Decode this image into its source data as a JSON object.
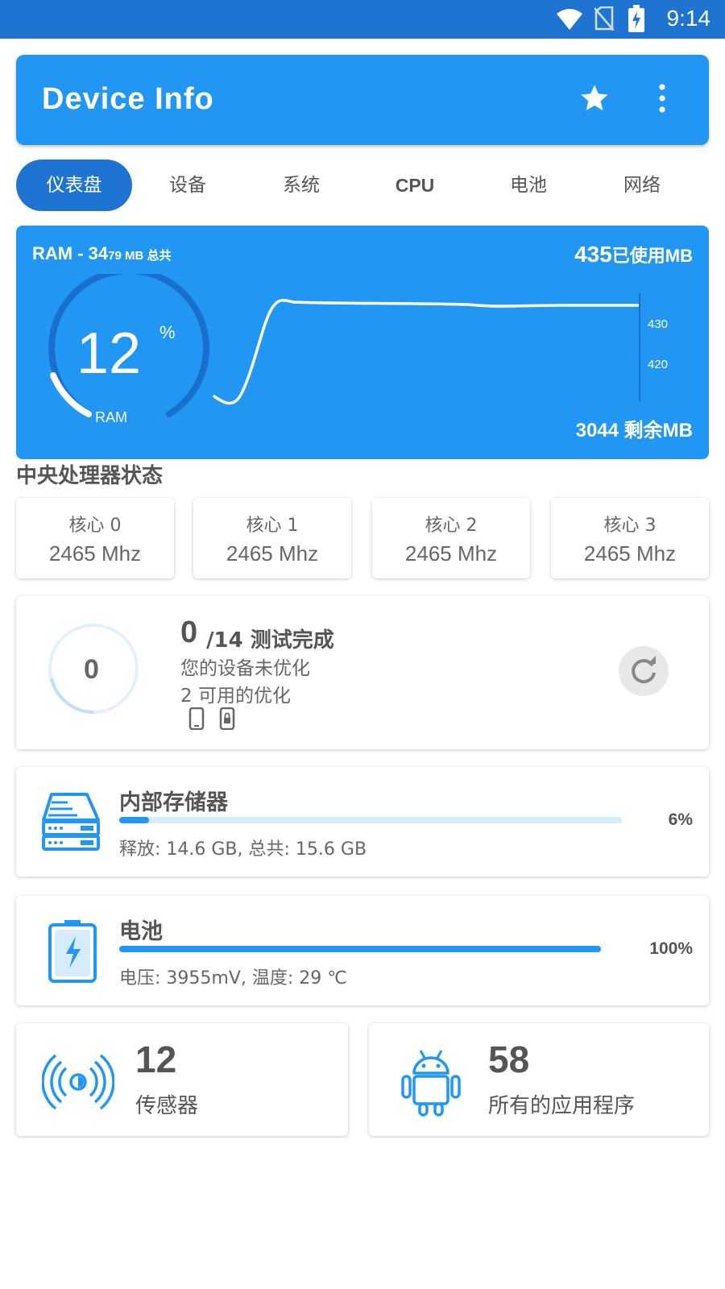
{
  "status_bar": {
    "time": "9:14"
  },
  "app_bar": {
    "title": "Device Info"
  },
  "tabs": [
    {
      "label": "仪表盘",
      "active": true
    },
    {
      "label": "设备"
    },
    {
      "label": "系统"
    },
    {
      "label": "CPU"
    },
    {
      "label": "电池"
    },
    {
      "label": "网络"
    }
  ],
  "ram": {
    "title_main": "RAM - 34",
    "title_small": "79 MB 总共",
    "used_value": "435",
    "used_unit": "已使用MB",
    "free_text": "3044 剩余MB",
    "percent": "12",
    "percent_sign": "%",
    "gauge_label": "RAM",
    "ticks": [
      "430",
      "420"
    ]
  },
  "cpu": {
    "section_title": "中央处理器状态",
    "cores": [
      {
        "name": "核心 0",
        "freq": "2465 Mhz"
      },
      {
        "name": "核心 1",
        "freq": "2465 Mhz"
      },
      {
        "name": "核心 2",
        "freq": "2465 Mhz"
      },
      {
        "name": "核心 3",
        "freq": "2465 Mhz"
      }
    ]
  },
  "optimize": {
    "score": "0",
    "count": "0",
    "total": "/14 测试完成",
    "line1": "您的设备未优化",
    "line2": "2 可用的优化"
  },
  "storage": {
    "name": "内部存储器",
    "percent": "6%",
    "fill": 0.06,
    "detail": "释放: 14.6 GB,  总共: 15.6 GB"
  },
  "battery": {
    "name": "电池",
    "percent": "100%",
    "fill": 1.0,
    "detail": "电压: 3955mV,  温度: 29 ℃"
  },
  "sensors": {
    "count": "12",
    "label": "传感器"
  },
  "apps": {
    "count": "58",
    "label": "所有的应用程序"
  },
  "colors": {
    "primary": "#2196f3",
    "dark": "#1f74d2"
  }
}
